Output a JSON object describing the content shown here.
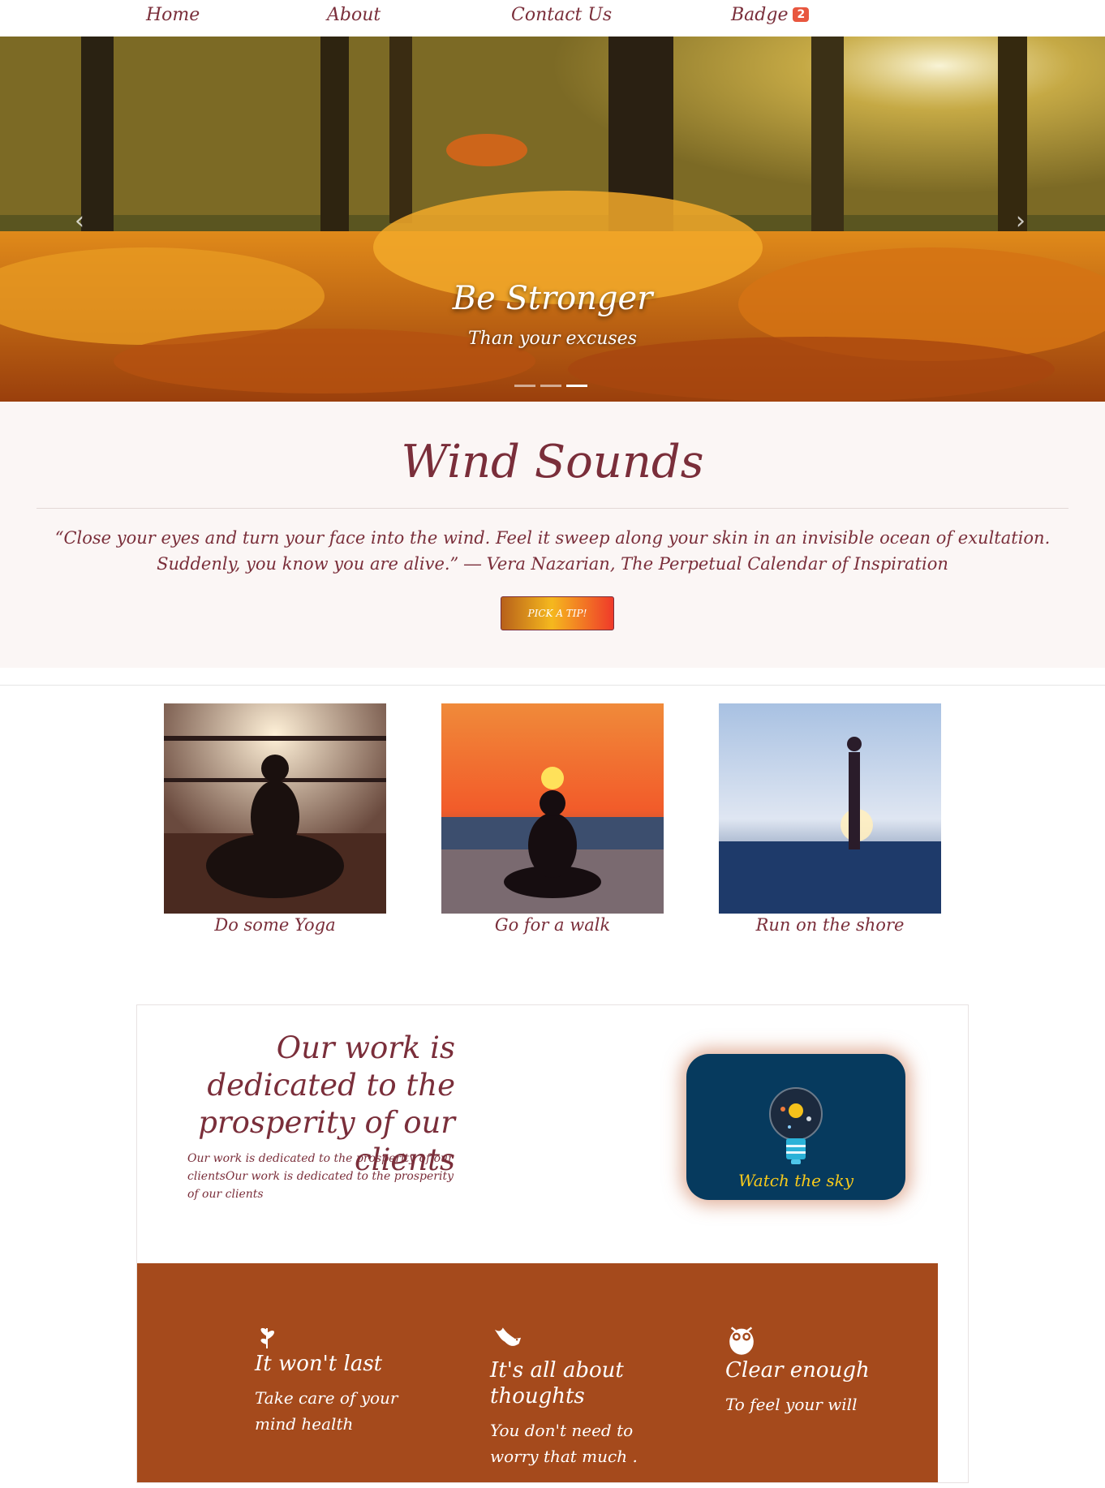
{
  "nav": {
    "home": "Home",
    "about": "About",
    "contact": "Contact Us",
    "badge_label": "Badge",
    "badge_count": "2"
  },
  "hero": {
    "title": "Be Stronger",
    "subtitle": "Than your excuses",
    "slide_count": 3,
    "active_slide": 3
  },
  "wind": {
    "title": "Wind Sounds",
    "quote": "“Close your eyes and turn your face into the wind. Feel it sweep along your skin in an invisible ocean of exultation. Suddenly, you know you are alive.” ― Vera Nazarian, The Perpetual Calendar of Inspiration",
    "button": "PICK A TIP!"
  },
  "cards": [
    {
      "caption": "Do some Yoga"
    },
    {
      "caption": "Go for a walk"
    },
    {
      "caption": "Run on the shore"
    }
  ],
  "dedicated": {
    "title": "Our work is dedicated to the prosperity of our clients",
    "text": "Our work is dedicated to the prosperity of our clientsOur work is dedicated to the prosperity of our clients",
    "sky_label": "Watch the sky"
  },
  "features": [
    {
      "icon": "leaf-icon",
      "title": "It won't last",
      "text": "Take care of your mind health"
    },
    {
      "icon": "dove-icon",
      "title": "It's all about thoughts",
      "text": "You don't need to worry that much ."
    },
    {
      "icon": "owl-icon",
      "title": "Clear enough",
      "text": "To feel your will"
    }
  ],
  "colors": {
    "brand": "#7a2e3a",
    "features_bg": "#a54a1c",
    "sky_card_bg": "#063a5e",
    "sky_label": "#f6c91c",
    "badge": "#e8573f"
  }
}
